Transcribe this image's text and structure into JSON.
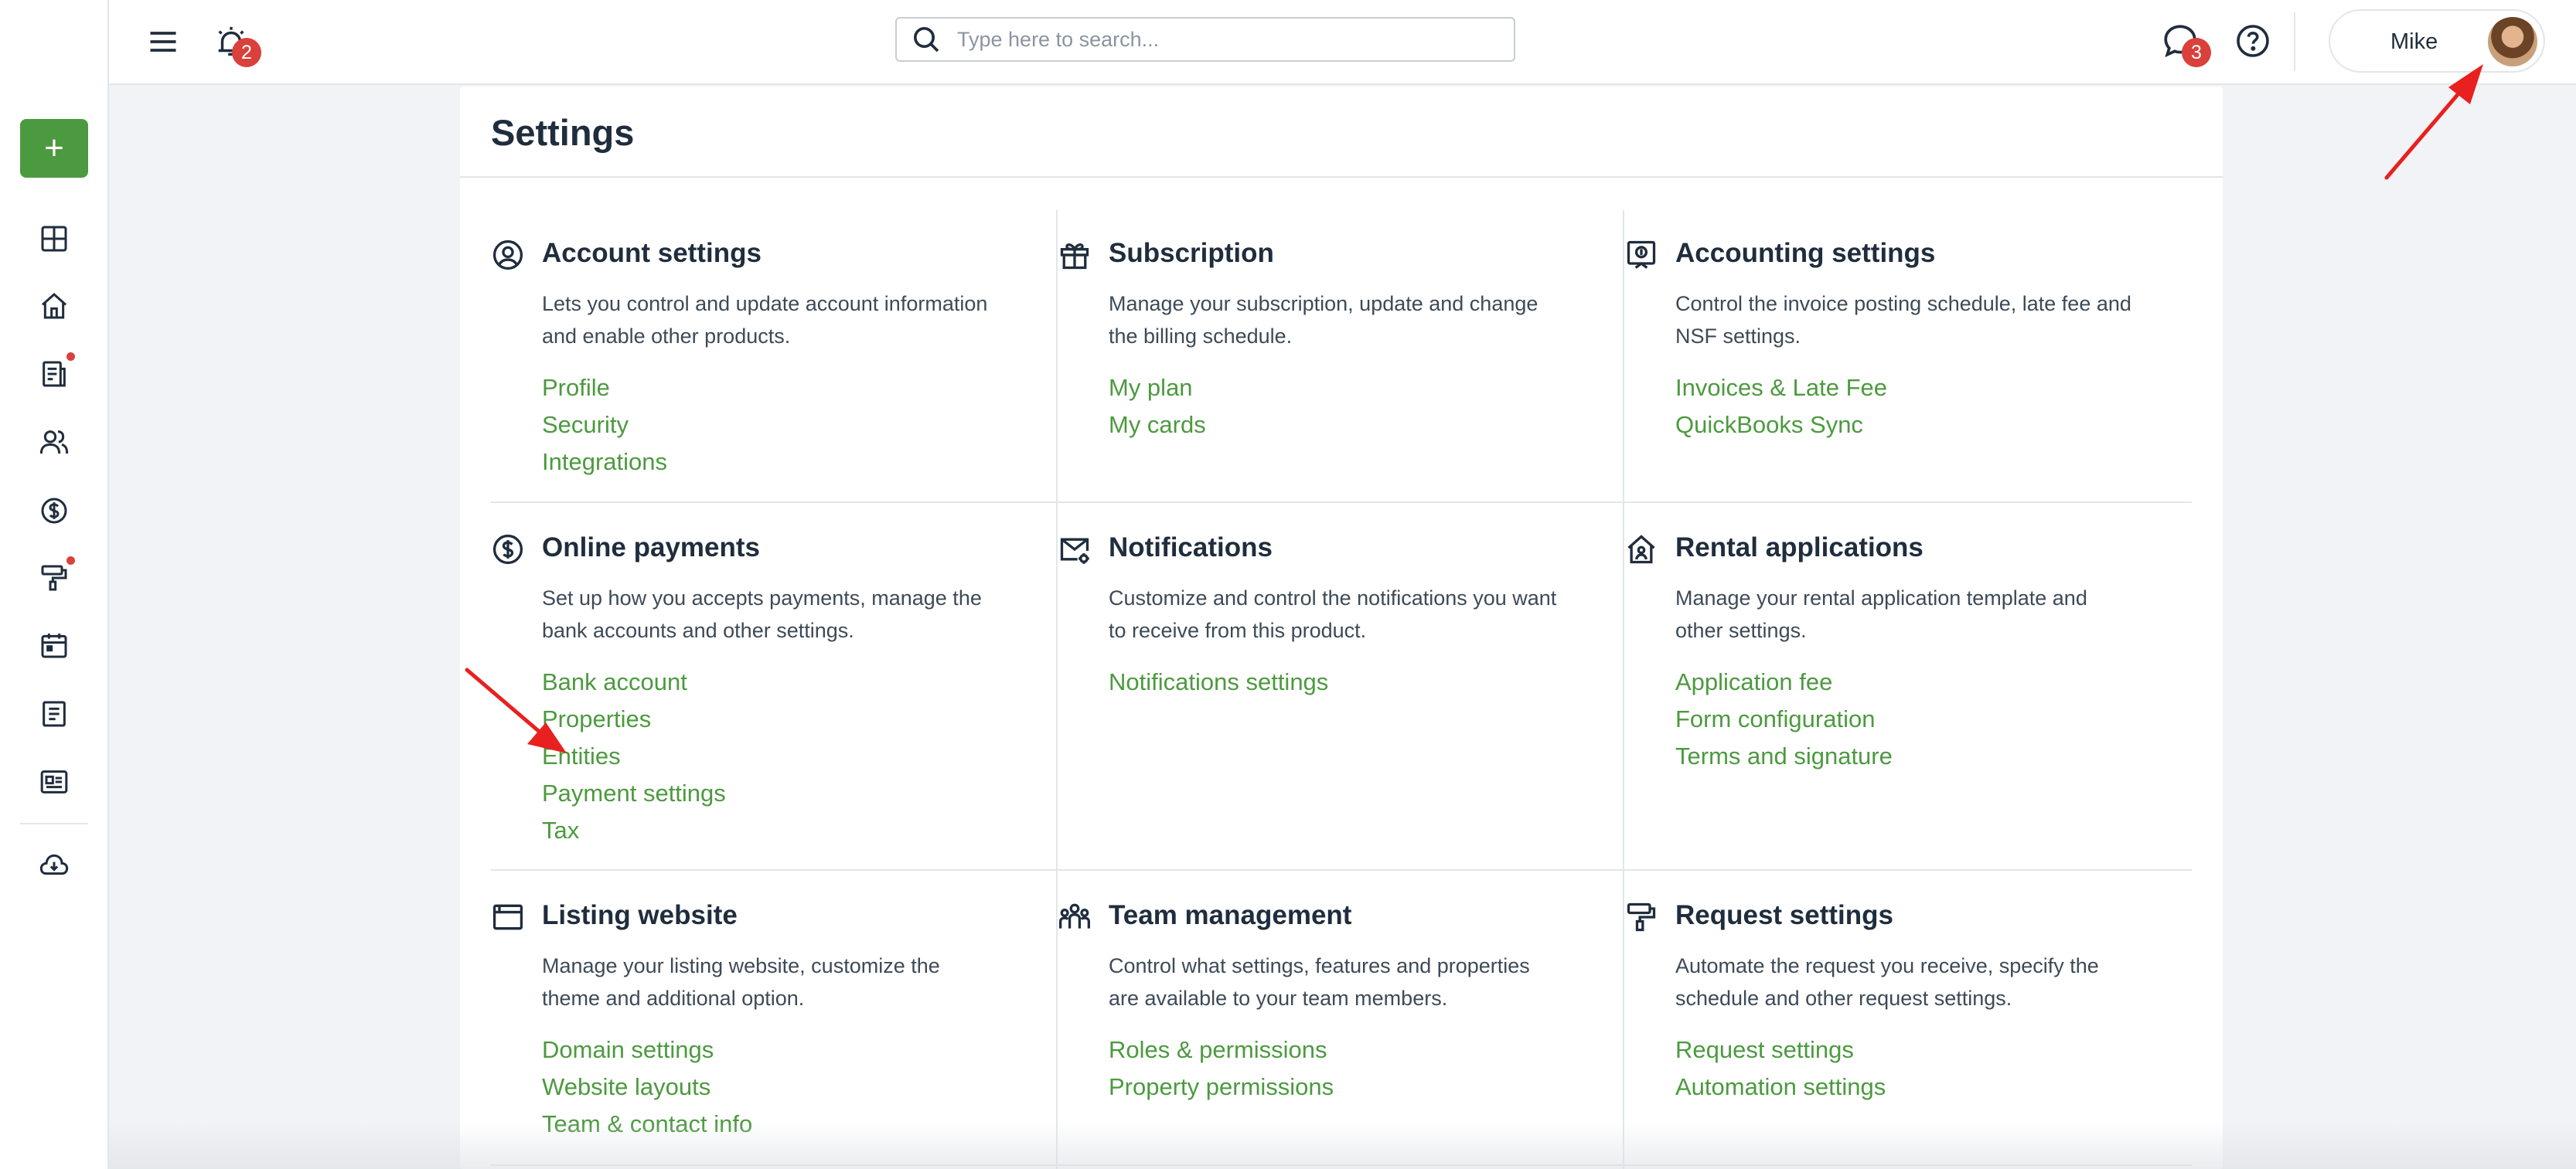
{
  "header": {
    "menu_icon": "hamburger-menu-icon",
    "alerts_icon": "alarm-bell-icon",
    "alerts_badge": "2",
    "search_placeholder": "Type here to search...",
    "messages_icon": "chat-bubble-icon",
    "messages_badge": "3",
    "help_icon": "question-circle-icon",
    "user_name": "Mike"
  },
  "sidebar": {
    "add_label": "+",
    "items": [
      {
        "icon": "dashboard-grid-icon",
        "dot": false
      },
      {
        "icon": "home-icon",
        "dot": false
      },
      {
        "icon": "documents-icon",
        "dot": true
      },
      {
        "icon": "people-icon",
        "dot": false
      },
      {
        "icon": "dollar-circle-icon",
        "dot": false
      },
      {
        "icon": "paint-roller-icon",
        "dot": true
      },
      {
        "icon": "calendar-icon",
        "dot": false
      },
      {
        "icon": "notes-icon",
        "dot": false
      },
      {
        "icon": "id-card-icon",
        "dot": false
      },
      {
        "icon": "cloud-download-icon",
        "dot": false
      }
    ]
  },
  "page": {
    "title": "Settings"
  },
  "sections": [
    {
      "title": "Account settings",
      "icon": "user-circle-icon",
      "description": "Lets you control and update account information and enable other products.",
      "links": [
        "Profile",
        "Security",
        "Integrations"
      ]
    },
    {
      "title": "Subscription",
      "icon": "gift-icon",
      "description": "Manage your subscription, update and change the billing schedule.",
      "links": [
        "My plan",
        "My cards"
      ]
    },
    {
      "title": "Accounting settings",
      "icon": "accounting-icon",
      "description": "Control the invoice posting schedule, late fee and NSF settings.",
      "links": [
        "Invoices & Late Fee",
        "QuickBooks Sync"
      ]
    },
    {
      "title": "Online payments",
      "icon": "dollar-circle-icon",
      "description": "Set up how you accepts payments, manage the bank accounts and other settings.",
      "links": [
        "Bank account",
        "Properties",
        "Entities",
        "Payment settings",
        "Tax"
      ]
    },
    {
      "title": "Notifications",
      "icon": "envelope-gear-icon",
      "description": "Customize and control the notifications you want to receive from this product.",
      "links": [
        "Notifications settings"
      ]
    },
    {
      "title": "Rental applications",
      "icon": "house-user-icon",
      "description": "Manage your rental application template and other settings.",
      "links": [
        "Application fee",
        "Form configuration",
        "Terms and signature"
      ]
    },
    {
      "title": "Listing website",
      "icon": "browser-window-icon",
      "description": "Manage your listing website, customize the theme and additional option.",
      "links": [
        "Domain settings",
        "Website layouts",
        "Team & contact info"
      ]
    },
    {
      "title": "Team management",
      "icon": "team-icon",
      "description": "Control what settings, features and properties are available to your team members.",
      "links": [
        "Roles & permissions",
        "Property permissions"
      ]
    },
    {
      "title": "Request settings",
      "icon": "paint-roller-icon",
      "description": "Automate the request you receive, specify the schedule and other request settings.",
      "links": [
        "Request settings",
        "Automation settings"
      ]
    }
  ],
  "colors": {
    "accent_green": "#4c9a3f",
    "badge_red": "#d9413a",
    "annotation_arrow": "#e8201f"
  }
}
